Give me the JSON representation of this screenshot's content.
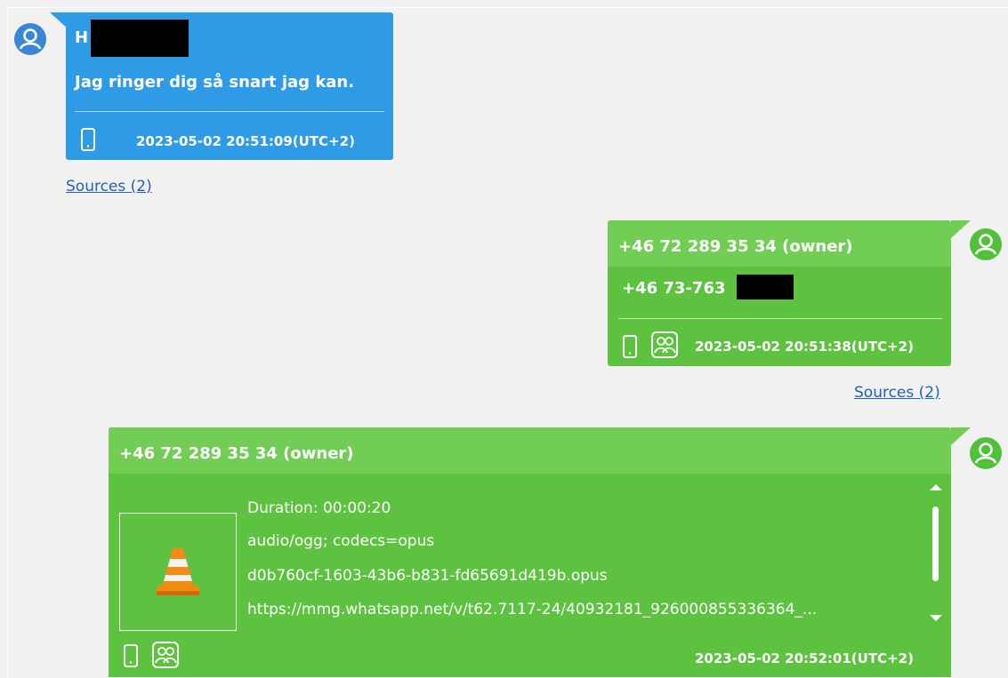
{
  "messages": [
    {
      "sender_prefix": "H",
      "text": "Jag ringer dig så snart jag kan.",
      "timestamp": "2023-05-02 20:51:09(UTC+2)",
      "sources": "Sources (2)"
    },
    {
      "sender": "+46 72 289 35 34 (owner)",
      "text": "+46 73-763",
      "timestamp": "2023-05-02 20:51:38(UTC+2)",
      "sources": "Sources (2)"
    },
    {
      "sender": "+46 72 289 35 34 (owner)",
      "attachment": {
        "duration": "Duration: 00:00:20",
        "mime": "audio/ogg; codecs=opus",
        "filename": "d0b760cf-1603-43b6-b831-fd65691d419b.opus",
        "url": "https://mmg.whatsapp.net/v/t62.7117-24/40932181_926000855336364_..."
      },
      "timestamp": "2023-05-02 20:52:01(UTC+2)"
    }
  ],
  "colors": {
    "incoming_bubble": "#2f9be6",
    "outgoing_bubble": "#5cc23f",
    "header_band": "#72cd55",
    "link": "#1f5fbf"
  },
  "icons": [
    "user-avatar-icon",
    "phone-icon",
    "group-icon",
    "vlc-cone-icon",
    "scroll-up-arrow",
    "scroll-down-arrow"
  ]
}
